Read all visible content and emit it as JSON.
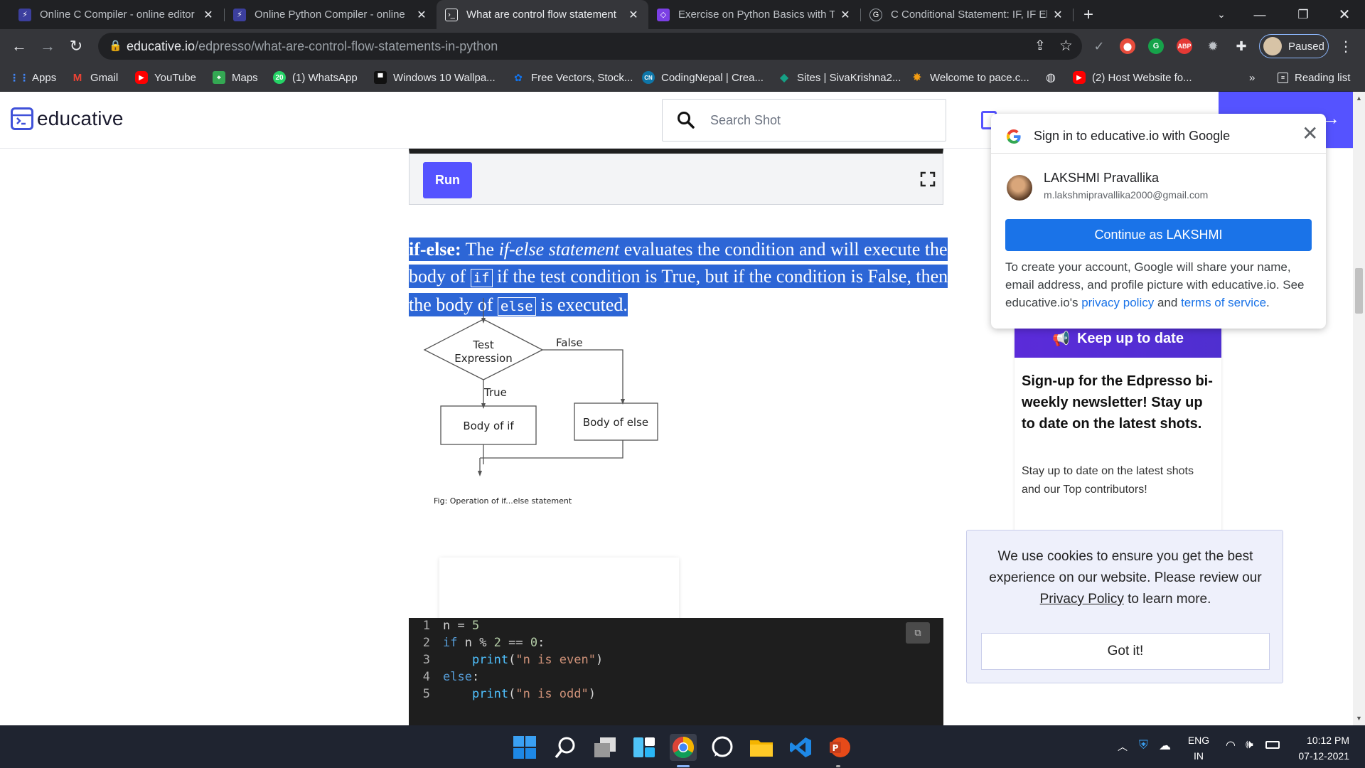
{
  "browser": {
    "tabs": [
      {
        "title": "Online C Compiler - online editor",
        "favicon": "bolt-icon",
        "color": "#3c3f9e"
      },
      {
        "title": "Online Python Compiler - online",
        "favicon": "bolt-icon",
        "color": "#3c3f9e"
      },
      {
        "title": "What are control flow statement",
        "favicon": "educative-icon",
        "color": "#5f6368"
      },
      {
        "title": "Exercise on Python Basics with Tu",
        "favicon": "tutorial-icon",
        "color": "#7b3fe4"
      },
      {
        "title": "C Conditional Statement: IF, IF El",
        "favicon": "guru-icon",
        "color": "#5f6368"
      }
    ],
    "url_domain": "educative.io",
    "url_path": "/edpresso/what-are-control-flow-statements-in-python",
    "profile_label": "Paused",
    "bookmarks": [
      {
        "label": "Apps",
        "icon": "apps-grid-icon",
        "color": "#4285f4"
      },
      {
        "label": "Gmail",
        "icon": "gmail-icon",
        "color": "#ea4335"
      },
      {
        "label": "YouTube",
        "icon": "youtube-icon",
        "color": "#ff0000"
      },
      {
        "label": "Maps",
        "icon": "maps-icon",
        "color": "#34a853"
      },
      {
        "label": "(1) WhatsApp",
        "icon": "whatsapp-icon",
        "color": "#25d366"
      },
      {
        "label": "Windows 10 Wallpa...",
        "icon": "wallpaper-icon",
        "color": "#333333"
      },
      {
        "label": "Free Vectors, Stock...",
        "icon": "freepik-icon",
        "color": "#1273eb"
      },
      {
        "label": "CodingNepal | Crea...",
        "icon": "codingnepal-icon",
        "color": "#0e76a8"
      },
      {
        "label": "Sites | SivaKrishna2...",
        "icon": "sites-icon",
        "color": "#16a085"
      },
      {
        "label": "Welcome to pace.c...",
        "icon": "pace-icon",
        "color": "#f39c12"
      },
      {
        "label": "",
        "icon": "globe-icon",
        "color": "#e8eaed"
      },
      {
        "label": "(2) Host Website fo...",
        "icon": "youtube-icon",
        "color": "#ff0000"
      }
    ],
    "more_bookmarks": "»",
    "reading_list": "Reading list"
  },
  "site": {
    "logo_text": "educative",
    "search_placeholder": "Search Shot"
  },
  "article": {
    "run_label": "Run",
    "para_term": "if-else:",
    "para_1": " The ",
    "para_italic": "if-else statement",
    "para_2": " evaluates the condition and will execute the body of ",
    "code_if": "if",
    "para_3": " if the test condition is True, but if the condition is False, then the body of ",
    "code_else": "else",
    "para_4": " is executed.",
    "flowchart": {
      "test_label_1": "Test",
      "test_label_2": "Expression",
      "false_label": "False",
      "true_label": "True",
      "body_if": "Body of if",
      "body_else": "Body of else",
      "caption": "Fig: Operation of if...else statement"
    },
    "code_lines": [
      {
        "n": "1",
        "text": "n = 5"
      },
      {
        "n": "2",
        "text": "if n % 2 == 0:"
      },
      {
        "n": "3",
        "text": "    print(\"n is even\")"
      },
      {
        "n": "4",
        "text": "else:"
      },
      {
        "n": "5",
        "text": "    print(\"n is odd\")"
      }
    ]
  },
  "sidebar": {
    "keep_label": "Keep up to date",
    "newsletter_head": "Sign-up for the Edpresso bi-weekly newsletter! Stay up to date on the latest shots.",
    "newsletter_sub": "Stay up to date on the latest shots and our Top contributors!"
  },
  "google_popup": {
    "title": "Sign in to educative.io with Google",
    "name": "LAKSHMI Pravallika",
    "email": "m.lakshmipravallika2000@gmail.com",
    "button": "Continue as LAKSHMI",
    "text_1": "To create your account, Google will share your name, email address, and profile picture with educative.io. See educative.io's ",
    "link_privacy": "privacy policy",
    "text_2": " and ",
    "link_terms": "terms of service",
    "text_3": "."
  },
  "cookie": {
    "text_1": "We use cookies to ensure you get the best experience on our website. Please review our ",
    "link": "Privacy Policy",
    "text_2": " to learn more.",
    "button": "Got it!"
  },
  "taskbar": {
    "lang_1": "ENG",
    "lang_2": "IN",
    "time": "10:12 PM",
    "date": "07-12-2021"
  }
}
